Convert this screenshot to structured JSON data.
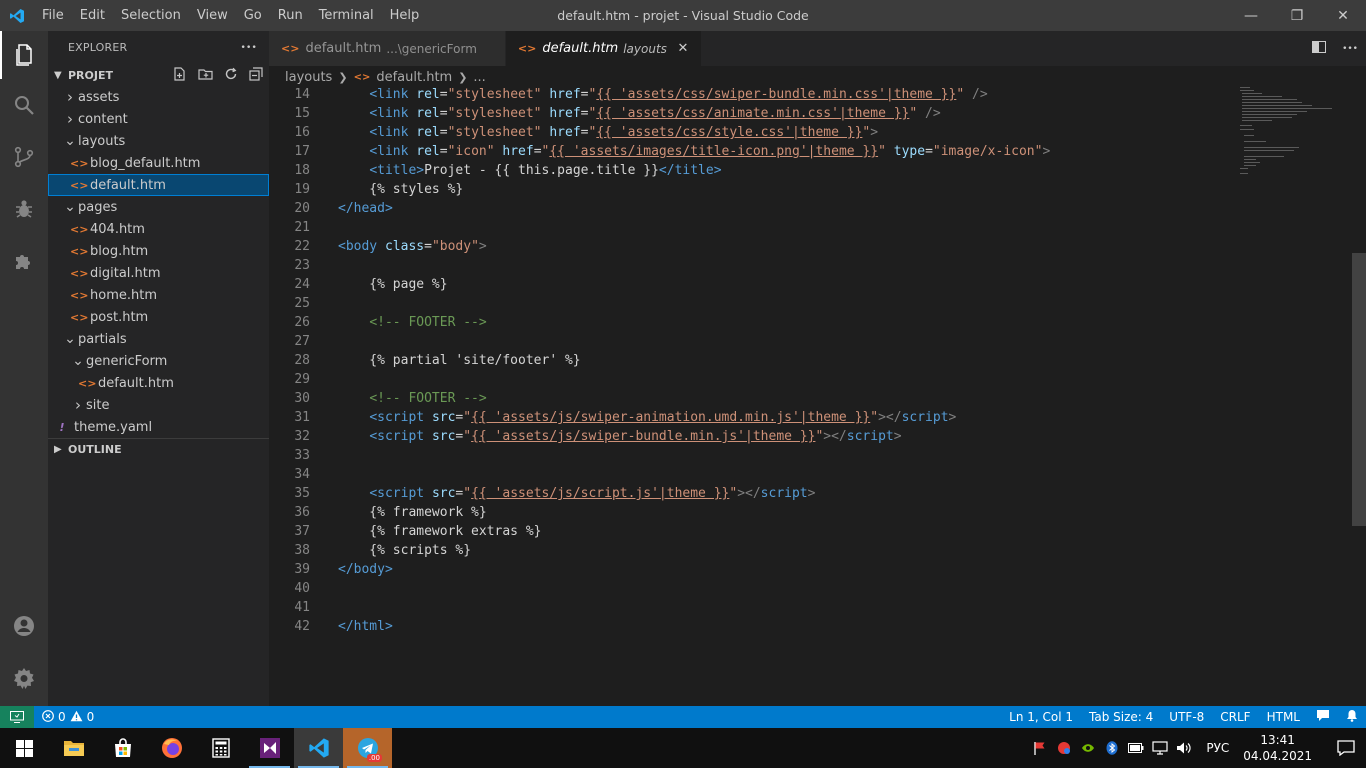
{
  "window": {
    "title": "default.htm - projet - Visual Studio Code",
    "menu": [
      "File",
      "Edit",
      "Selection",
      "View",
      "Go",
      "Run",
      "Terminal",
      "Help"
    ],
    "minimize": "—",
    "restore": "❐",
    "close": "✕"
  },
  "sidebar": {
    "header": "EXPLORER",
    "more": "•••",
    "section": "PROJET",
    "outline": "OUTLINE",
    "tree": [
      {
        "label": "assets",
        "type": "folder",
        "open": false,
        "depth": 0
      },
      {
        "label": "content",
        "type": "folder",
        "open": false,
        "depth": 0
      },
      {
        "label": "layouts",
        "type": "folder",
        "open": true,
        "depth": 0
      },
      {
        "label": "blog_default.htm",
        "type": "html",
        "depth": 1
      },
      {
        "label": "default.htm",
        "type": "html",
        "depth": 1,
        "selected": true
      },
      {
        "label": "pages",
        "type": "folder",
        "open": true,
        "depth": 0
      },
      {
        "label": "404.htm",
        "type": "html",
        "depth": 1
      },
      {
        "label": "blog.htm",
        "type": "html",
        "depth": 1
      },
      {
        "label": "digital.htm",
        "type": "html",
        "depth": 1
      },
      {
        "label": "home.htm",
        "type": "html",
        "depth": 1
      },
      {
        "label": "post.htm",
        "type": "html",
        "depth": 1
      },
      {
        "label": "partials",
        "type": "folder",
        "open": true,
        "depth": 0
      },
      {
        "label": "genericForm",
        "type": "folder",
        "open": true,
        "depth": 1
      },
      {
        "label": "default.htm",
        "type": "html",
        "depth": 2
      },
      {
        "label": "site",
        "type": "folder",
        "open": false,
        "depth": 1
      },
      {
        "label": "theme.yaml",
        "type": "yaml",
        "depth": 0
      }
    ]
  },
  "tabs": [
    {
      "label": "default.htm",
      "desc": "...\\genericForm",
      "active": false
    },
    {
      "label": "default.htm",
      "desc": "layouts",
      "active": true
    }
  ],
  "breadcrumb": {
    "folder": "layouts",
    "file": "default.htm",
    "more": "..."
  },
  "code": [
    {
      "n": "14",
      "t": [
        [
          "    ",
          "p"
        ],
        [
          "<link ",
          "tag"
        ],
        [
          "rel",
          "attr"
        ],
        [
          "=",
          "p"
        ],
        [
          "\"stylesheet\"",
          "str"
        ],
        [
          " ",
          "p"
        ],
        [
          "href",
          "attr"
        ],
        [
          "=",
          "p"
        ],
        [
          "\"",
          "str"
        ],
        [
          "{{ 'assets/css/swiper-bundle.min.css'|theme }}",
          "twig"
        ],
        [
          "\"",
          "str"
        ],
        [
          " />",
          "pu"
        ]
      ]
    },
    {
      "n": "15",
      "t": [
        [
          "    ",
          "p"
        ],
        [
          "<link ",
          "tag"
        ],
        [
          "rel",
          "attr"
        ],
        [
          "=",
          "p"
        ],
        [
          "\"stylesheet\"",
          "str"
        ],
        [
          " ",
          "p"
        ],
        [
          "href",
          "attr"
        ],
        [
          "=",
          "p"
        ],
        [
          "\"",
          "str"
        ],
        [
          "{{ 'assets/css/animate.min.css'|theme }}",
          "twig"
        ],
        [
          "\"",
          "str"
        ],
        [
          " />",
          "pu"
        ]
      ]
    },
    {
      "n": "16",
      "t": [
        [
          "    ",
          "p"
        ],
        [
          "<link ",
          "tag"
        ],
        [
          "rel",
          "attr"
        ],
        [
          "=",
          "p"
        ],
        [
          "\"stylesheet\"",
          "str"
        ],
        [
          " ",
          "p"
        ],
        [
          "href",
          "attr"
        ],
        [
          "=",
          "p"
        ],
        [
          "\"",
          "str"
        ],
        [
          "{{ 'assets/css/style.css'|theme }}",
          "twig"
        ],
        [
          "\"",
          "str"
        ],
        [
          ">",
          "pu"
        ]
      ]
    },
    {
      "n": "17",
      "t": [
        [
          "    ",
          "p"
        ],
        [
          "<link ",
          "tag"
        ],
        [
          "rel",
          "attr"
        ],
        [
          "=",
          "p"
        ],
        [
          "\"icon\"",
          "str"
        ],
        [
          " ",
          "p"
        ],
        [
          "href",
          "attr"
        ],
        [
          "=",
          "p"
        ],
        [
          "\"",
          "str"
        ],
        [
          "{{ 'assets/images/title-icon.png'|theme }}",
          "twig"
        ],
        [
          "\"",
          "str"
        ],
        [
          " ",
          "p"
        ],
        [
          "type",
          "attr"
        ],
        [
          "=",
          "p"
        ],
        [
          "\"image/x-icon\"",
          "str"
        ],
        [
          ">",
          "pu"
        ]
      ]
    },
    {
      "n": "18",
      "t": [
        [
          "    ",
          "p"
        ],
        [
          "<title>",
          "tag"
        ],
        [
          "Projet - {{ this.page.title }}",
          "p"
        ],
        [
          "</title>",
          "tag"
        ]
      ]
    },
    {
      "n": "19",
      "t": [
        [
          "    {% styles %}",
          "p"
        ]
      ]
    },
    {
      "n": "20",
      "t": [
        [
          "</head>",
          "tag"
        ]
      ]
    },
    {
      "n": "21",
      "t": []
    },
    {
      "n": "22",
      "t": [
        [
          "<body ",
          "tag"
        ],
        [
          "class",
          "attr"
        ],
        [
          "=",
          "p"
        ],
        [
          "\"body\"",
          "str"
        ],
        [
          ">",
          "pu"
        ]
      ]
    },
    {
      "n": "23",
      "t": []
    },
    {
      "n": "24",
      "t": [
        [
          "    {% page %}",
          "p"
        ]
      ]
    },
    {
      "n": "25",
      "t": []
    },
    {
      "n": "26",
      "t": [
        [
          "    ",
          "p"
        ],
        [
          "<!-- FOOTER -->",
          "cmt"
        ]
      ]
    },
    {
      "n": "27",
      "t": []
    },
    {
      "n": "28",
      "t": [
        [
          "    {% partial 'site/footer' %}",
          "p"
        ]
      ]
    },
    {
      "n": "29",
      "t": []
    },
    {
      "n": "30",
      "t": [
        [
          "    ",
          "p"
        ],
        [
          "<!-- FOOTER -->",
          "cmt"
        ]
      ]
    },
    {
      "n": "31",
      "t": [
        [
          "    ",
          "p"
        ],
        [
          "<script ",
          "tag"
        ],
        [
          "src",
          "attr"
        ],
        [
          "=",
          "p"
        ],
        [
          "\"",
          "str"
        ],
        [
          "{{ 'assets/js/swiper-animation.umd.min.js'|theme }}",
          "twig"
        ],
        [
          "\"",
          "str"
        ],
        [
          "></",
          "pu"
        ],
        [
          "script",
          "tag"
        ],
        [
          ">",
          "pu"
        ]
      ]
    },
    {
      "n": "32",
      "t": [
        [
          "    ",
          "p"
        ],
        [
          "<script ",
          "tag"
        ],
        [
          "src",
          "attr"
        ],
        [
          "=",
          "p"
        ],
        [
          "\"",
          "str"
        ],
        [
          "{{ 'assets/js/swiper-bundle.min.js'|theme }}",
          "twig"
        ],
        [
          "\"",
          "str"
        ],
        [
          "></",
          "pu"
        ],
        [
          "script",
          "tag"
        ],
        [
          ">",
          "pu"
        ]
      ]
    },
    {
      "n": "33",
      "t": []
    },
    {
      "n": "34",
      "t": []
    },
    {
      "n": "35",
      "t": [
        [
          "    ",
          "p"
        ],
        [
          "<script ",
          "tag"
        ],
        [
          "src",
          "attr"
        ],
        [
          "=",
          "p"
        ],
        [
          "\"",
          "str"
        ],
        [
          "{{ 'assets/js/script.js'|theme }}",
          "twig"
        ],
        [
          "\"",
          "str"
        ],
        [
          "></",
          "pu"
        ],
        [
          "script",
          "tag"
        ],
        [
          ">",
          "pu"
        ]
      ]
    },
    {
      "n": "36",
      "t": [
        [
          "    {% framework %}",
          "p"
        ]
      ]
    },
    {
      "n": "37",
      "t": [
        [
          "    {% framework extras %}",
          "p"
        ]
      ]
    },
    {
      "n": "38",
      "t": [
        [
          "    {% scripts %}",
          "p"
        ]
      ]
    },
    {
      "n": "39",
      "t": [
        [
          "</body>",
          "tag"
        ]
      ]
    },
    {
      "n": "40",
      "t": []
    },
    {
      "n": "41",
      "t": []
    },
    {
      "n": "42",
      "t": [
        [
          "</html>",
          "tag"
        ]
      ]
    }
  ],
  "status": {
    "errors": "0",
    "warnings": "0",
    "position": "Ln 1, Col 1",
    "tabsize": "Tab Size: 4",
    "encoding": "UTF-8",
    "eol": "CRLF",
    "language": "HTML"
  },
  "taskbar": {
    "lang": "РУС",
    "time": "13:41",
    "date": "04.04.2021",
    "telegram_badge": ".00"
  },
  "colors": {
    "accent": "#007acc",
    "tag": "#569cd6",
    "attr": "#9cdcfe",
    "string": "#ce9178",
    "comment": "#6a9955",
    "html_icon": "#e37933"
  }
}
